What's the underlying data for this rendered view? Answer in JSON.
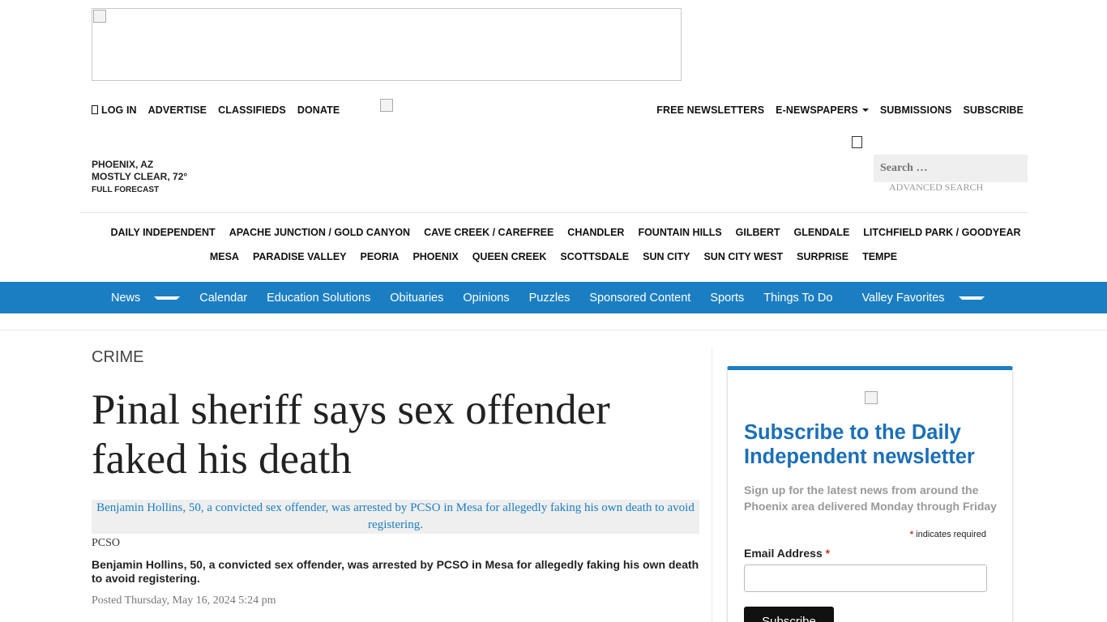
{
  "top_nav_left": {
    "login": "LOG IN",
    "advertise": "ADVERTISE",
    "classifieds": "CLASSIFIEDS",
    "donate": "DONATE"
  },
  "top_nav_right": {
    "newsletters": "FREE NEWSLETTERS",
    "enewspapers": "E-NEWSPAPERS",
    "submissions": "SUBMISSIONS",
    "subscribe": "SUBSCRIBE"
  },
  "weather": {
    "location": "PHOENIX, AZ",
    "condition": "MOSTLY CLEAR, 72°",
    "forecast_link": "FULL FORECAST"
  },
  "search": {
    "placeholder": "Search …",
    "advanced": "ADVANCED SEARCH"
  },
  "cities_row1": [
    "DAILY INDEPENDENT",
    "APACHE JUNCTION / GOLD CANYON",
    "CAVE CREEK / CAREFREE",
    "CHANDLER",
    "FOUNTAIN HILLS",
    "GILBERT",
    "GLENDALE",
    "LITCHFIELD PARK / GOODYEAR"
  ],
  "cities_row2": [
    "MESA",
    "PARADISE VALLEY",
    "PEORIA",
    "PHOENIX",
    "QUEEN CREEK",
    "SCOTTSDALE",
    "SUN CITY",
    "SUN CITY WEST",
    "SURPRISE",
    "TEMPE"
  ],
  "main_nav": {
    "news": "News",
    "calendar": "Calendar",
    "education": "Education Solutions",
    "obituaries": "Obituaries",
    "opinions": "Opinions",
    "puzzles": "Puzzles",
    "sponsored": "Sponsored Content",
    "sports": "Sports",
    "things_to_do": "Things To Do",
    "valley_favorites": "Valley Favorites"
  },
  "article": {
    "section": "CRIME",
    "headline": "Pinal sheriff says sex offender faked his death",
    "photo_alt": "Benjamin Hollins, 50, a convicted sex offender, was arrested by PCSO in Mesa for allegedly faking his own death to avoid registering.",
    "photo_credit": "PCSO",
    "caption": "Benjamin Hollins, 50, a convicted sex offender, was arrested by PCSO in Mesa for allegedly faking his own death to avoid registering.",
    "posted": "Posted Thursday, May 16, 2024 5:24 pm"
  },
  "newsletter": {
    "title": "Subscribe to the Daily Independent newsletter",
    "description": "Sign up for the latest news from around the Phoenix area delivered Monday through Friday",
    "required_star": "*",
    "required_note": "indicates required",
    "email_label": "Email Address",
    "email_star": "*",
    "button": "Subscribe"
  },
  "colors": {
    "brand_blue": "#1b7ec2",
    "title_blue": "#1b6fb8"
  }
}
